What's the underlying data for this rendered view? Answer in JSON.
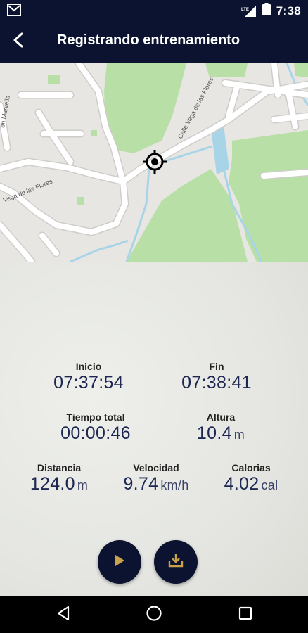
{
  "status_bar": {
    "time": "7:38",
    "network_label": "LTE",
    "icons": [
      "mail-icon",
      "lte-signal-icon",
      "battery-icon"
    ]
  },
  "header": {
    "title": "Registrando entrenamiento",
    "back_icon": "back-arrow-icon"
  },
  "map": {
    "street_labels": [
      "Calle Vega de las Flores",
      "Vega de las Flores",
      "en Marvella"
    ],
    "location_icon": "crosshair-location-icon"
  },
  "stats": {
    "inicio": {
      "label": "Inicio",
      "value": "07:37:54"
    },
    "fin": {
      "label": "Fin",
      "value": "07:38:41"
    },
    "tiempo_total": {
      "label": "Tiempo total",
      "value": "00:00:46"
    },
    "altura": {
      "label": "Altura",
      "value": "10.4",
      "unit": "m"
    },
    "distancia": {
      "label": "Distancia",
      "value": "124.0",
      "unit": "m"
    },
    "velocidad": {
      "label": "Velocidad",
      "value": "9.74",
      "unit": "km/h"
    },
    "calorias": {
      "label": "Calorias",
      "value": "4.02",
      "unit": "cal"
    }
  },
  "actions": {
    "play_icon": "play-icon",
    "download_icon": "download-icon",
    "accent": "#c9a24a"
  },
  "nav": {
    "icons": [
      "back-triangle-icon",
      "home-circle-icon",
      "recents-square-icon"
    ]
  },
  "colors": {
    "primary": "#0c1330",
    "value_text": "#1d2751",
    "map_green": "#b5dfa1",
    "map_water": "#a8d4e8"
  }
}
